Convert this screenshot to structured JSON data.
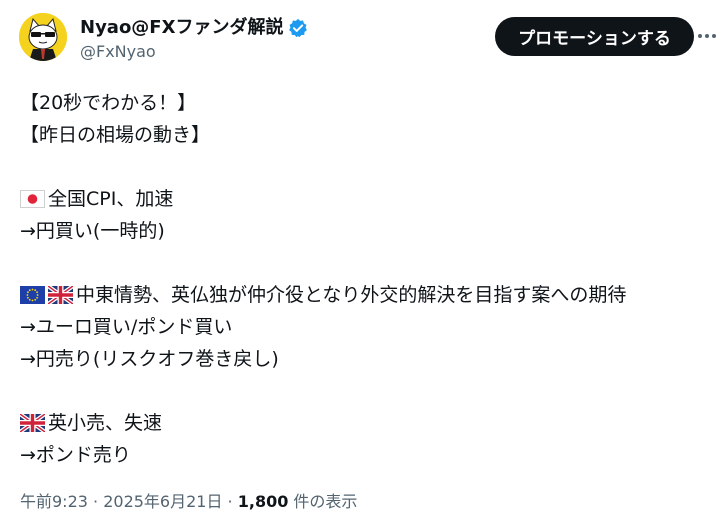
{
  "author": {
    "display_name": "Nyao@FXファンダ解説",
    "handle": "@FxNyao",
    "verified_color": "#1d9bf0",
    "avatar_color": "#f4d21e"
  },
  "actions": {
    "promote_label": "プロモーションする",
    "more_icon": "more-horizontal-icon"
  },
  "tweet": {
    "lines": {
      "l1": "【20秒でわかる！】",
      "l2": "【昨日の相場の動き】",
      "l3": "全国CPI、加速",
      "l4": "→円買い(一時的)",
      "l5": "中東情勢、英仏独が仲介役となり外交的解決を目指す案への期待",
      "l6": "→ユーロ買い/ポンド買い",
      "l7": "→円売り(リスクオフ巻き戻し)",
      "l8": "英小売、失速",
      "l9": "→ポンド売り"
    },
    "flags": [
      "japan-flag",
      "eu-flag",
      "uk-flag"
    ]
  },
  "meta": {
    "time": "午前9:23",
    "sep1": " · ",
    "date": "2025年6月21日",
    "sep2": " · ",
    "views": "1,800",
    "views_label": " 件の表示"
  }
}
